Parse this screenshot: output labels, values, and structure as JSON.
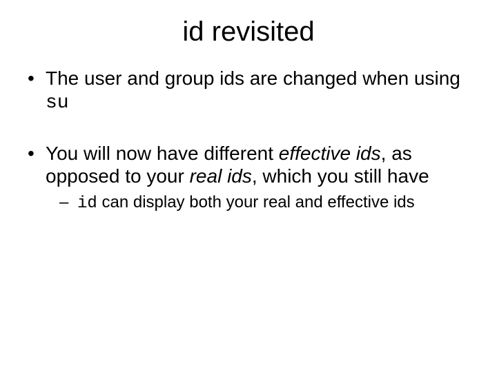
{
  "title": "id revisited",
  "bullets": {
    "b1_pre": "The user and group ids are changed when using ",
    "b1_code": "su",
    "b2_t1": "You will now have different ",
    "b2_i1": "effective ids",
    "b2_t2": ", as opposed to your ",
    "b2_i2": "real ids",
    "b2_t3": ", which you still have",
    "b2_sub_code": "id",
    "b2_sub_rest": " can display both your real and effective ids"
  }
}
